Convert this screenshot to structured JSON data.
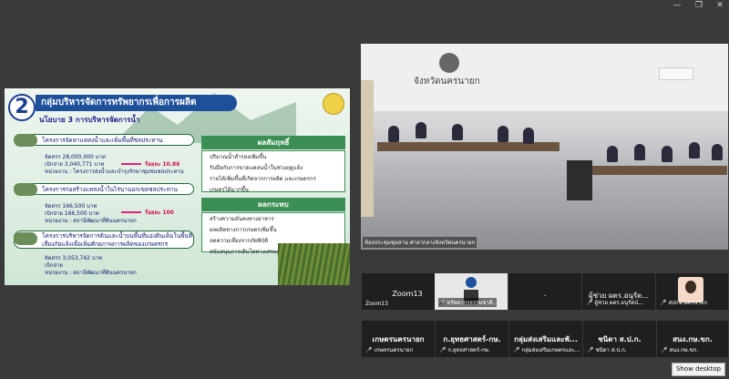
{
  "window": {
    "controls": [
      "—",
      "❐",
      "✕"
    ]
  },
  "slide": {
    "number": "2",
    "title": "กลุ่มบริหารจัดการทรัพยากรเพื่อการผลิต",
    "subtitle": "นโยบาย 3 การบริหารจัดการน้ำ",
    "projects": [
      {
        "title": "โครงการจัดหาแหล่งน้ำและเพิ่มพื้นที่ชลประทาน",
        "lines": [
          "จัดสรร 28,000,000 บาท",
          "เบิกจ่าย 3,040,771 บาท",
          "หน่วยงาน : โครงการส่งน้ำและบำรุงรักษาชุมชนชลประทาน"
        ],
        "percent": "ร้อยละ 10.86"
      },
      {
        "title": "โครงการก่อสร้างแหล่งน้ำในไร่นานอกเขตชลประทาน",
        "lines": [
          "จัดสรร 166,500 บาท",
          "เบิกจ่าย 166,500 บาท",
          "หน่วยงาน : สถานีพัฒนาที่ดินนครนายก"
        ],
        "percent": "ร้อยละ 100"
      },
      {
        "title": "โครงการบริหารจัดการดินและน้ำบนพื้นที่แอ่งดินเค็มในพื้นที่เสี่ยงภัยแล้งเพื่อเพิ่มศักยภาพการผลิตของเกษตรกร",
        "lines": [
          "จัดสรร 3,053,742 บาท",
          "เบิกจ่าย",
          "หน่วยงาน : สถานีพัฒนาที่ดินนครนายก"
        ],
        "percent": ""
      }
    ],
    "result_box": {
      "title": "ผลสัมฤทธิ์",
      "items": [
        "ปริมาณน้ำสำรองเพิ่มขึ้น",
        "รับมือกับการขาดแคลนน้ำในช่วงฤดูแล้ง",
        "รายได้เพิ่มขึ้นที่เกิดจากการผลิต และเกษตรกร",
        "เกษตรได้มากขึ้น"
      ]
    },
    "impact_box": {
      "title": "ผลกระทบ",
      "items": [
        "สร้างความมั่นคงทางอาหาร",
        "ผลผลิตทางการเกษตรเพิ่มขึ้น",
        "ลดความเสี่ยงจากภัยพิบัติ",
        "สนับสนุนการเติบโตทางเศรษฐกิจ"
      ]
    }
  },
  "camera": {
    "sign_text": "จังหวัดนครนายก",
    "caption": "ห้องประชุมชุมสาน ศาลากลางจังหวัดนครนายก"
  },
  "participants": [
    {
      "name": "Zoom13",
      "label": "Zoom13",
      "muted": false,
      "style": "plain"
    },
    {
      "name": "",
      "label": "ทรัพยากรธรรมชาติ..",
      "muted": true,
      "style": "video"
    },
    {
      "name": ".",
      "label": "",
      "muted": false,
      "style": "plain"
    },
    {
      "name": "ผู้ช่วย ผตร.อนุรัต...",
      "label": "ผู้ช่วย ผตร.อนุรัตน์...",
      "muted": true,
      "style": "plain"
    },
    {
      "name": "",
      "label": "สปกจ.นครนายก",
      "muted": true,
      "style": "avatar"
    },
    {
      "name": "เกษตรนครนายก",
      "label": "เกษตรนครนายก",
      "muted": true,
      "style": "bold"
    },
    {
      "name": "ก.ยุทธศาสตร์-กษ.",
      "label": "ก.ยุทธศาสตร์-กษ.",
      "muted": true,
      "style": "bold"
    },
    {
      "name": "กลุ่มส่งเสริมและพั...",
      "label": "กลุ่มส่งเสริมเกษตรและ...",
      "muted": true,
      "style": "bold"
    },
    {
      "name": "ชนิดา ส.ป.ก.",
      "label": "ชนิดา ส.ป.ก.",
      "muted": true,
      "style": "bold"
    },
    {
      "name": "สนง.กษ.ขก.",
      "label": "สนง.กษ.ขก.",
      "muted": true,
      "style": "bold"
    }
  ],
  "show_desktop_label": "Show desktop",
  "colors": {
    "background": "#3a3a3a",
    "tile": "#1f1f1f",
    "mic_muted": "#e23030",
    "slide_title_bg": "#1d4f9a",
    "box_header": "#3c8f54"
  }
}
